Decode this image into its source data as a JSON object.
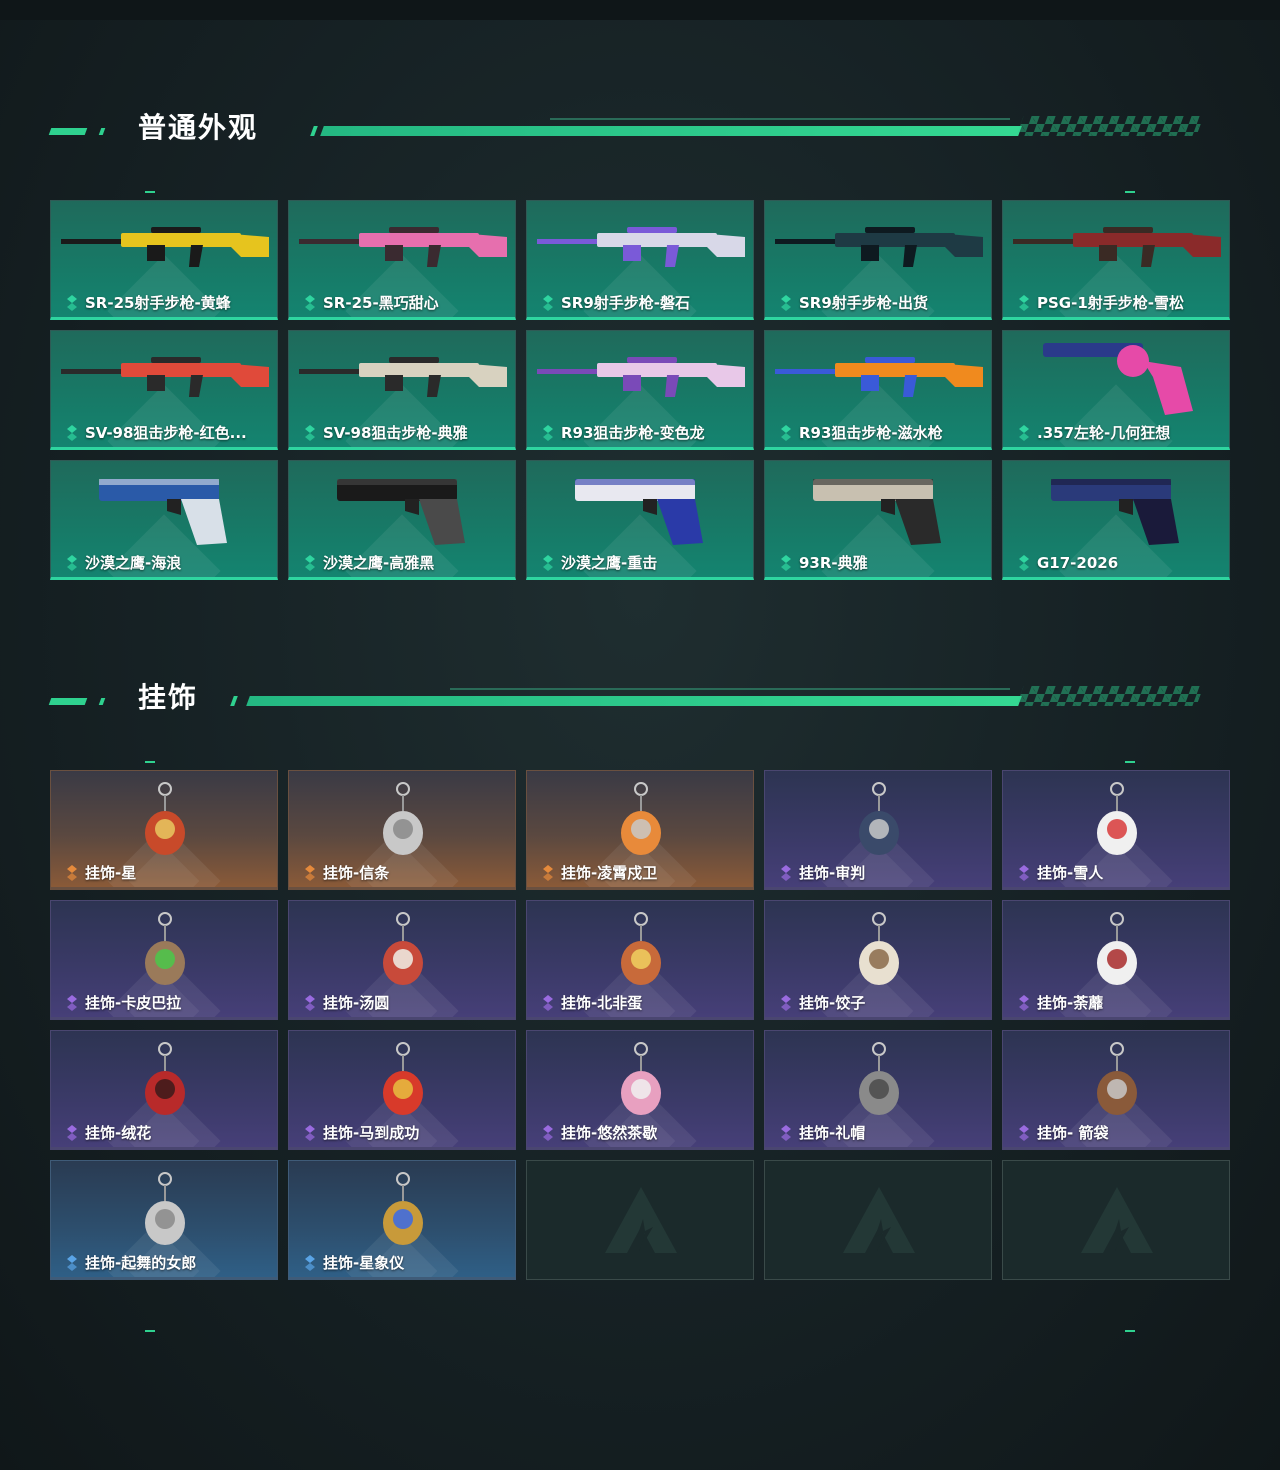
{
  "sections": {
    "skins": {
      "title": "普通外观",
      "items": [
        {
          "label": "SR-25射手步枪-黄蜂",
          "icon": "rifle-icon",
          "colors": [
            "#e6c41e",
            "#1a1a1a"
          ]
        },
        {
          "label": "SR-25-黑巧甜心",
          "icon": "rifle-icon",
          "colors": [
            "#e66fae",
            "#3a2a30"
          ]
        },
        {
          "label": "SR9射手步枪-磐石",
          "icon": "rifle-icon",
          "colors": [
            "#d8d8e8",
            "#7a5ad8"
          ]
        },
        {
          "label": "SR9射手步枪-出货",
          "icon": "rifle-icon",
          "colors": [
            "#1e3a44",
            "#0e1a20"
          ]
        },
        {
          "label": "PSG-1射手步枪-雪松",
          "icon": "rifle-icon",
          "colors": [
            "#8a2a2a",
            "#3a2a24"
          ]
        },
        {
          "label": "SV-98狙击步枪-红色...",
          "icon": "sniper-icon",
          "colors": [
            "#e04a3a",
            "#2a2a2a"
          ]
        },
        {
          "label": "SV-98狙击步枪-典雅",
          "icon": "sniper-icon",
          "colors": [
            "#d8d2c0",
            "#2a2a2a"
          ]
        },
        {
          "label": "R93狙击步枪-变色龙",
          "icon": "sniper-icon",
          "colors": [
            "#e8c8e8",
            "#7a4ab8"
          ]
        },
        {
          "label": "R93狙击步枪-滋水枪",
          "icon": "sniper-icon",
          "colors": [
            "#f08a1e",
            "#3a5ad8"
          ]
        },
        {
          "label": ".357左轮-几何狂想",
          "icon": "revolver-icon",
          "colors": [
            "#e64aa8",
            "#2a3a8a"
          ]
        },
        {
          "label": "沙漠之鹰-海浪",
          "icon": "pistol-icon",
          "colors": [
            "#2a5aa8",
            "#d8e0e8"
          ]
        },
        {
          "label": "沙漠之鹰-高雅黑",
          "icon": "pistol-icon",
          "colors": [
            "#1a1a1a",
            "#4a4a4a"
          ]
        },
        {
          "label": "沙漠之鹰-重击",
          "icon": "pistol-icon",
          "colors": [
            "#e8e8f0",
            "#2a3aa8"
          ]
        },
        {
          "label": "93R-典雅",
          "icon": "pistol-icon",
          "colors": [
            "#c8c0b0",
            "#2a2a2a"
          ]
        },
        {
          "label": "G17-2026",
          "icon": "pistol-icon",
          "colors": [
            "#2a3a7a",
            "#1a1a3a"
          ]
        }
      ]
    },
    "charms": {
      "title": "挂饰",
      "items": [
        {
          "label": "挂饰-星",
          "rarity": "orange",
          "icon": "tarot-card-charm-icon",
          "colors": [
            "#c84a2a",
            "#e8c860"
          ]
        },
        {
          "label": "挂饰-信条",
          "rarity": "orange",
          "icon": "eagle-charm-icon",
          "colors": [
            "#c8c8c8",
            "#8a8a8a"
          ]
        },
        {
          "label": "挂饰-凌霄戍卫",
          "rarity": "orange",
          "icon": "rocket-charm-icon",
          "colors": [
            "#e88a3a",
            "#c8c8c8"
          ]
        },
        {
          "label": "挂饰-审判",
          "rarity": "purple",
          "icon": "card-charm-icon",
          "colors": [
            "#3a4a6a",
            "#c8c8c8"
          ]
        },
        {
          "label": "挂饰-雪人",
          "rarity": "purple",
          "icon": "snowman-charm-icon",
          "colors": [
            "#f0f0f0",
            "#d83a3a"
          ]
        },
        {
          "label": "挂饰-卡皮巴拉",
          "rarity": "purple",
          "icon": "capybara-charm-icon",
          "colors": [
            "#9a7a5a",
            "#4ac84a"
          ]
        },
        {
          "label": "挂饰-汤圆",
          "rarity": "purple",
          "icon": "bowl-charm-icon",
          "colors": [
            "#c84a3a",
            "#f0f0e8"
          ]
        },
        {
          "label": "挂饰-北非蛋",
          "rarity": "purple",
          "icon": "pan-charm-icon",
          "colors": [
            "#c86a3a",
            "#f0d060"
          ]
        },
        {
          "label": "挂饰-饺子",
          "rarity": "purple",
          "icon": "dumpling-charm-icon",
          "colors": [
            "#e8e0d0",
            "#8a6a4a"
          ]
        },
        {
          "label": "挂饰-荼蘼",
          "rarity": "purple",
          "icon": "flower-charm-icon",
          "colors": [
            "#f0f0f0",
            "#a82a2a"
          ]
        },
        {
          "label": "挂饰-绒花",
          "rarity": "purple",
          "icon": "rose-charm-icon",
          "colors": [
            "#b82a2a",
            "#3a1a1a"
          ]
        },
        {
          "label": "挂饰-马到成功",
          "rarity": "purple",
          "icon": "horse-charm-icon",
          "colors": [
            "#d83a2a",
            "#e8c040"
          ]
        },
        {
          "label": "挂饰-悠然茶歇",
          "rarity": "purple",
          "icon": "cupcake-charm-icon",
          "colors": [
            "#e8a0c0",
            "#f0f0f0"
          ]
        },
        {
          "label": "挂饰-礼帽",
          "rarity": "purple",
          "icon": "hat-charm-icon",
          "colors": [
            "#8a8a8a",
            "#4a4a4a"
          ]
        },
        {
          "label": "挂饰- 箭袋",
          "rarity": "purple",
          "icon": "quiver-charm-icon",
          "colors": [
            "#8a5a3a",
            "#c8c8c8"
          ]
        },
        {
          "label": "挂饰-起舞的女郎",
          "rarity": "blue",
          "icon": "dancer-charm-icon",
          "colors": [
            "#c8c8c8",
            "#8a8a8a"
          ]
        },
        {
          "label": "挂饰-星象仪",
          "rarity": "blue",
          "icon": "astrolabe-charm-icon",
          "colors": [
            "#c89a3a",
            "#3a6ae8"
          ]
        },
        {
          "label": "",
          "rarity": "empty",
          "icon": "placeholder-logo-icon"
        },
        {
          "label": "",
          "rarity": "empty",
          "icon": "placeholder-logo-icon"
        },
        {
          "label": "",
          "rarity": "empty",
          "icon": "placeholder-logo-icon"
        }
      ]
    }
  },
  "rarity_colors": {
    "green": "#2fd5a0",
    "orange": "#e58a3c",
    "purple": "#9a6be0",
    "blue": "#5aa4e6"
  },
  "accent": "#2fd18f"
}
